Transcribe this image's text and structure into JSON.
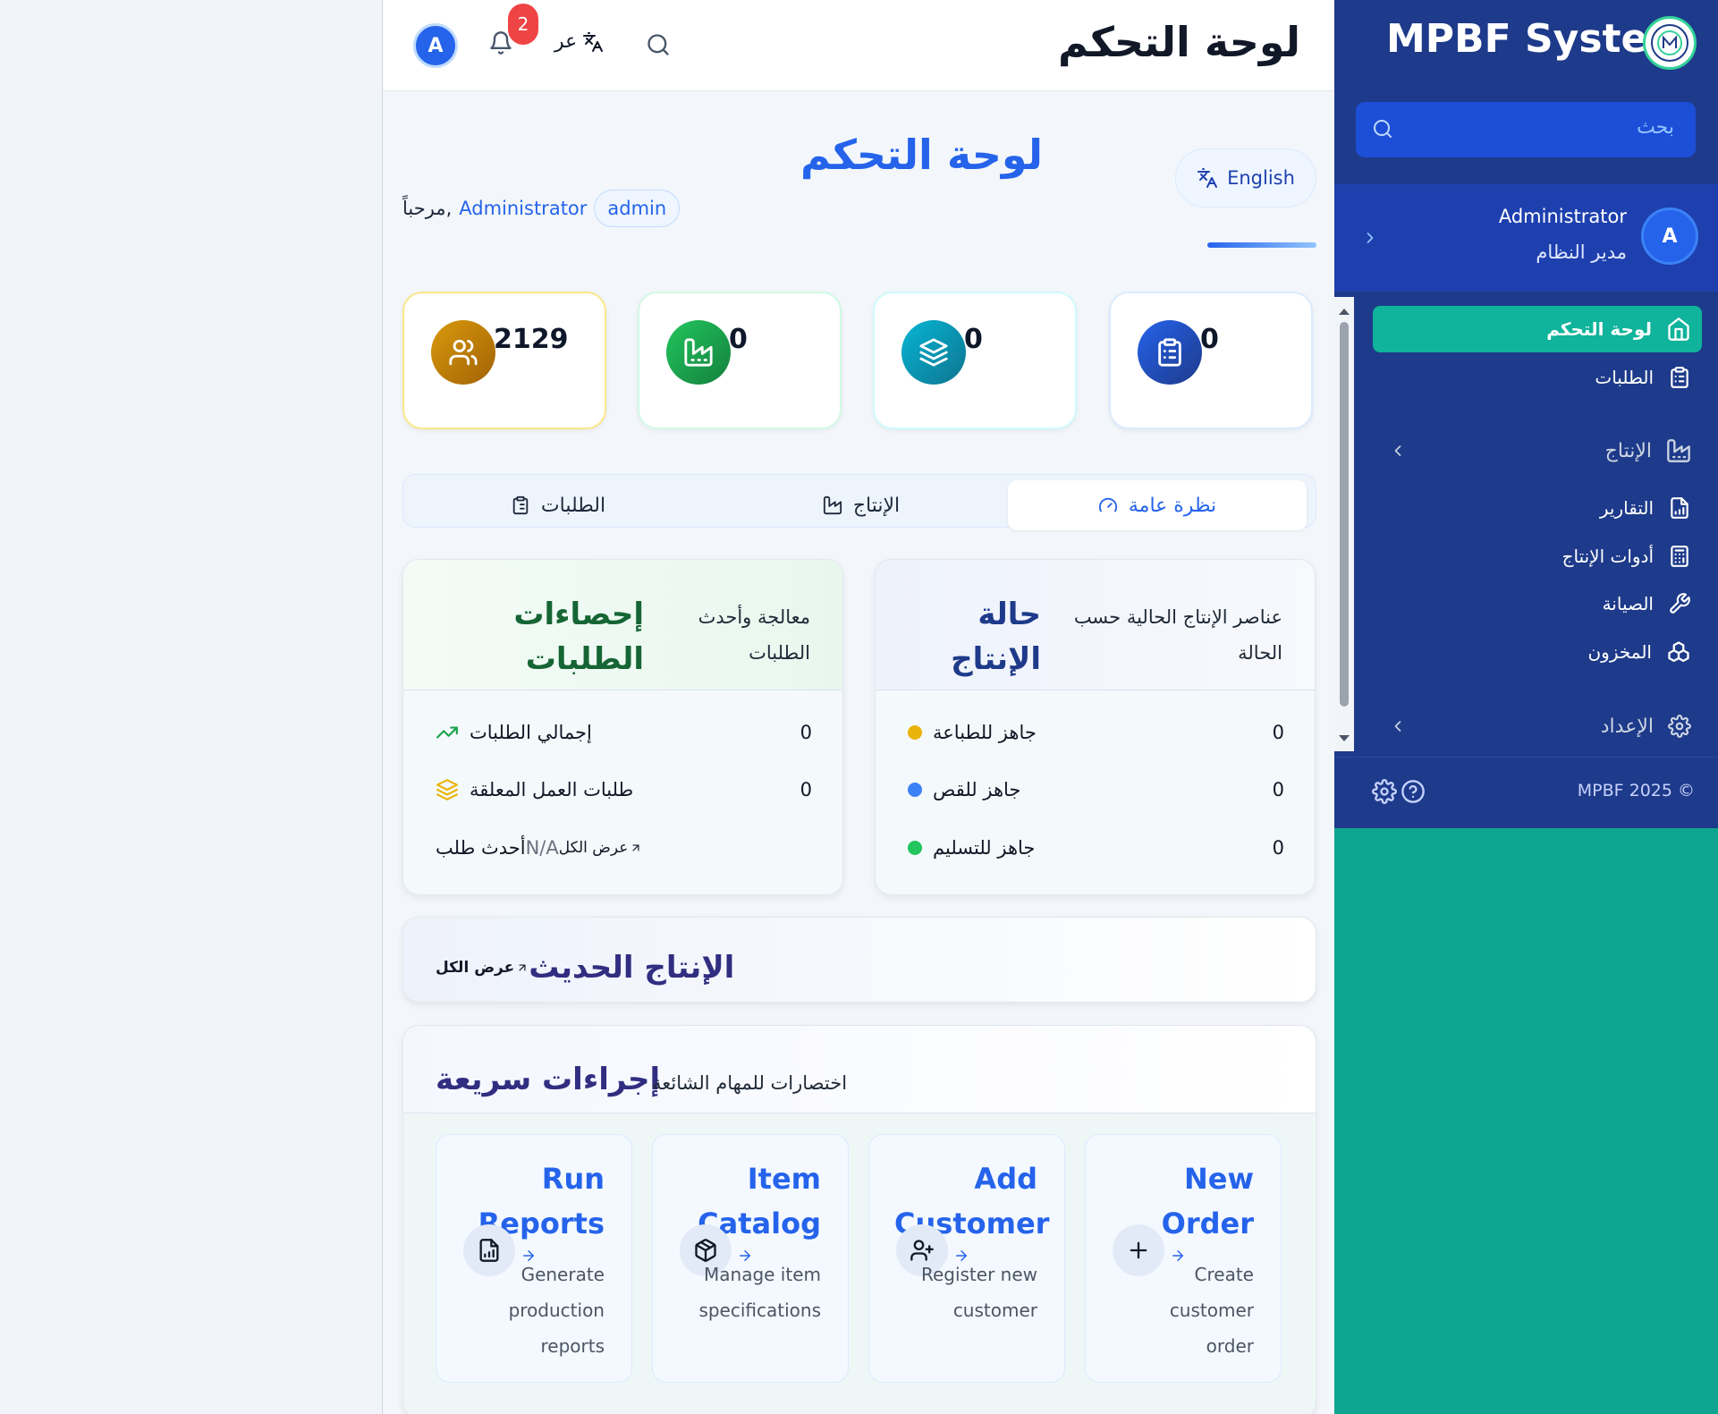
{
  "topbar": {
    "title": "لوحة التحكم",
    "avatar_letter": "A",
    "notifications_count": "2",
    "language_label": "عر"
  },
  "header": {
    "title": "لوحة التحكم",
    "welcome_prefix": "مرحباً,",
    "user_name": "Administrator",
    "role": "admin",
    "english_button": "English"
  },
  "stats": [
    {
      "value": "0",
      "icon": "clipboard-icon",
      "color": "#1e40af"
    },
    {
      "value": "0",
      "icon": "layers-icon",
      "color": "#0e7490"
    },
    {
      "value": "0",
      "icon": "factory-icon",
      "color": "#16a34a"
    },
    {
      "value": "2129",
      "icon": "users-icon",
      "color": "#b7791f"
    }
  ],
  "tabs": [
    {
      "label": "نظرة عامة",
      "icon": "gauge-icon",
      "active": true
    },
    {
      "label": "الإنتاج",
      "icon": "factory-icon",
      "active": false
    },
    {
      "label": "الطلبات",
      "icon": "clipboard-icon",
      "active": false
    }
  ],
  "production_status": {
    "title": "حالة الإنتاج",
    "subtitle": "عناصر الإنتاج الحالية حسب الحالة",
    "rows": [
      {
        "label": "جاهز للطباعة",
        "value": "0",
        "color": "#eab308"
      },
      {
        "label": "جاهز للقص",
        "value": "0",
        "color": "#3b82f6"
      },
      {
        "label": "جاهز للتسليم",
        "value": "0",
        "color": "#22c55e"
      }
    ]
  },
  "orders_stats": {
    "title": "إحصاءات الطلبات",
    "subtitle": "معالجة وأحدث الطلبات",
    "rows": [
      {
        "label": "إجمالي الطلبات",
        "value": "0",
        "icon": "trending-up-icon"
      },
      {
        "label": "طلبات العمل المعلقة",
        "value": "0",
        "icon": "layers-icon"
      }
    ],
    "latest_label": "أحدث طلب",
    "latest_value": "N/A",
    "view_all": "عرض الكل"
  },
  "recent_production": {
    "title": "الإنتاج الحديث",
    "view_all": "عرض الكل"
  },
  "quick_actions": {
    "title": "إجراءات سريعة",
    "subtitle": "اختصارات للمهام الشائعة",
    "items": [
      {
        "title": "New Order",
        "desc": "Create customer order",
        "icon": "plus-icon"
      },
      {
        "title": "Add Customer",
        "desc": "Register new customer",
        "icon": "user-plus-icon"
      },
      {
        "title": "Item Catalog",
        "desc": "Manage item specifications",
        "icon": "package-icon"
      },
      {
        "title": "Run Reports",
        "desc": "Generate production reports",
        "icon": "report-icon"
      }
    ]
  },
  "sidebar": {
    "brand": "MPBF System",
    "search_placeholder": "بحث",
    "user_name": "Administrator",
    "user_role": "مدير النظام",
    "user_initial": "A",
    "items": [
      {
        "label": "لوحة التحكم",
        "icon": "home-icon",
        "active": true
      },
      {
        "label": "الطلبات",
        "icon": "clipboard-icon"
      },
      {
        "label": "الإنتاج",
        "icon": "factory-icon",
        "group": true
      },
      {
        "label": "التقارير",
        "icon": "report-icon"
      },
      {
        "label": "أدوات الإنتاج",
        "icon": "calculator-icon"
      },
      {
        "label": "الصيانة",
        "icon": "wrench-icon"
      },
      {
        "label": "المخزون",
        "icon": "boxes-icon"
      },
      {
        "label": "الإعداد",
        "icon": "settings-icon",
        "group": true
      }
    ],
    "footer": "MPBF 2025 ©"
  }
}
